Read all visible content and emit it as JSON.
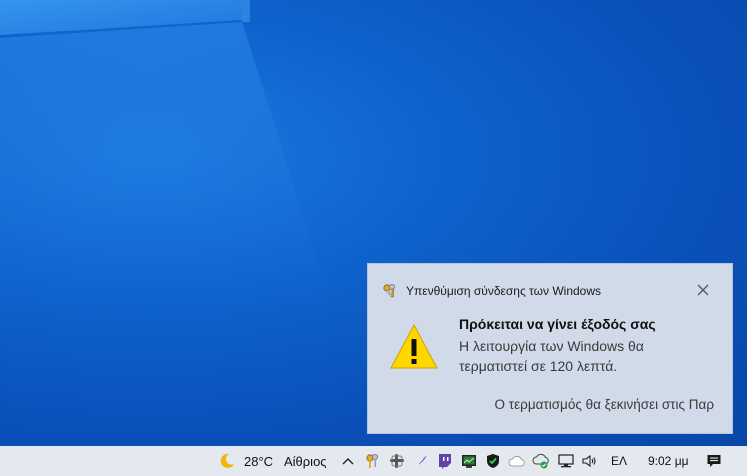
{
  "notification": {
    "app_name": "Υπενθύμιση σύνδεσης των Windows",
    "title": "Πρόκειται να γίνει έξοδός σας",
    "body": "Η λειτουργία των Windows θα τερματιστεί σε 120 λεπτά.",
    "footer": "Ο τερματισμός θα ξεκινήσει στις Παρ",
    "icons": {
      "app": "keys-icon",
      "main": "warning-icon",
      "close": "close-icon"
    }
  },
  "taskbar": {
    "weather": {
      "temperature": "28°C",
      "condition": "Αίθριος",
      "icon": "moon-icon"
    },
    "tray_icons": [
      "chevron-up-icon",
      "keys-icon",
      "slack-icon",
      "feather-icon",
      "twitch-icon",
      "monitor-icon",
      "shield-icon",
      "cloud-icon",
      "cloud-sync-icon",
      "network-icon",
      "volume-icon"
    ],
    "language": "ΕΛ",
    "clock": "9:02 μμ",
    "notification_center_icon": "action-center-icon"
  },
  "colors": {
    "desktop": "#0f62cc",
    "toast_bg": "#d1dae8",
    "taskbar_bg": "#e4e8ef",
    "warning_yellow": "#ffd700"
  }
}
